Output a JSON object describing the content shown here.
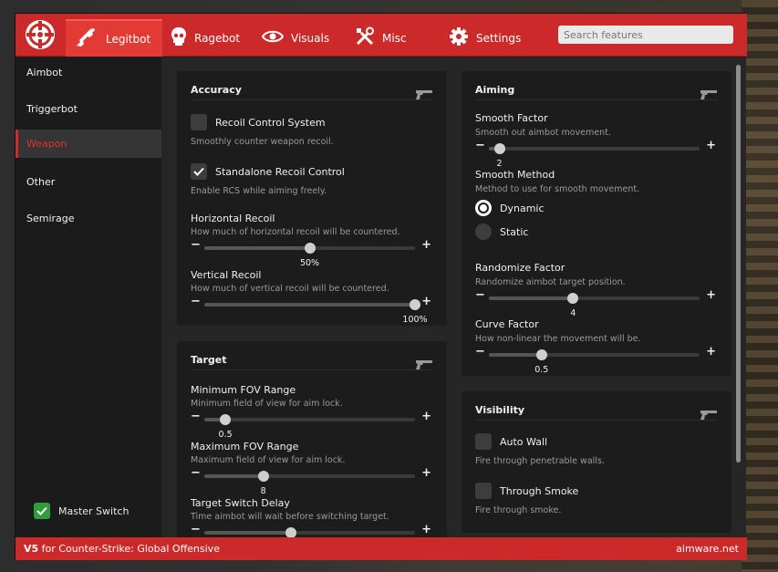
{
  "header": {
    "tabs": [
      {
        "label": "Legitbot",
        "icon": "rifle-icon",
        "active": true
      },
      {
        "label": "Ragebot",
        "icon": "skull-icon"
      },
      {
        "label": "Visuals",
        "icon": "eye-icon"
      },
      {
        "label": "Misc",
        "icon": "tools-icon"
      },
      {
        "label": "Settings",
        "icon": "gear-icon"
      }
    ],
    "search_placeholder": "Search features"
  },
  "sidebar": {
    "items": [
      {
        "label": "Aimbot"
      },
      {
        "label": "Triggerbot"
      },
      {
        "label": "Weapon",
        "active": true
      },
      {
        "label": "Other"
      },
      {
        "label": "Semirage"
      }
    ],
    "master_switch": {
      "label": "Master Switch",
      "checked": true
    }
  },
  "accuracy": {
    "title": "Accuracy",
    "rcs": {
      "label": "Recoil Control System",
      "desc": "Smoothly counter weapon recoil.",
      "checked": false
    },
    "standalone": {
      "label": "Standalone Recoil Control",
      "desc": "Enable RCS while aiming freely.",
      "checked": true
    },
    "horizontal": {
      "label": "Horizontal Recoil",
      "desc": "How much of horizontal recoil will be countered.",
      "value": "50%",
      "fraction": 0.5
    },
    "vertical": {
      "label": "Vertical Recoil",
      "desc": "How much of vertical recoil will be countered.",
      "value": "100%",
      "fraction": 1.0
    }
  },
  "target": {
    "title": "Target",
    "min_fov": {
      "label": "Minimum FOV Range",
      "desc": "Minimum field of view for aim lock.",
      "value": "0.5",
      "fraction": 0.1
    },
    "max_fov": {
      "label": "Maximum FOV Range",
      "desc": "Maximum field of view for aim lock.",
      "value": "8",
      "fraction": 0.28
    },
    "switch_delay": {
      "label": "Target Switch Delay",
      "desc": "Time aimbot will wait before switching target.",
      "fraction": 0.41
    }
  },
  "aiming": {
    "title": "Aiming",
    "smooth_factor": {
      "label": "Smooth Factor",
      "desc": "Smooth out aimbot movement.",
      "value": "2",
      "fraction": 0.05
    },
    "smooth_method": {
      "label": "Smooth Method",
      "desc": "Method to use for smooth movement.",
      "options": [
        "Dynamic",
        "Static"
      ],
      "selected": "Dynamic"
    },
    "randomize": {
      "label": "Randomize Factor",
      "desc": "Randomize aimbot target position.",
      "value": "4",
      "fraction": 0.4
    },
    "curve": {
      "label": "Curve Factor",
      "desc": "How non-linear the movement will be.",
      "value": "0.5",
      "fraction": 0.25
    }
  },
  "visibility": {
    "title": "Visibility",
    "autowall": {
      "label": "Auto Wall",
      "desc": "Fire through penetrable walls.",
      "checked": false
    },
    "smoke": {
      "label": "Through Smoke",
      "desc": "Fire through smoke.",
      "checked": false
    }
  },
  "footer": {
    "version": "V5",
    "game": " for Counter-Strike: Global Offensive",
    "site": "aimware.net"
  },
  "colors": {
    "accent": "#cc2a2a",
    "panel": "#1c1c1c",
    "check_green": "#2e9e3c"
  }
}
